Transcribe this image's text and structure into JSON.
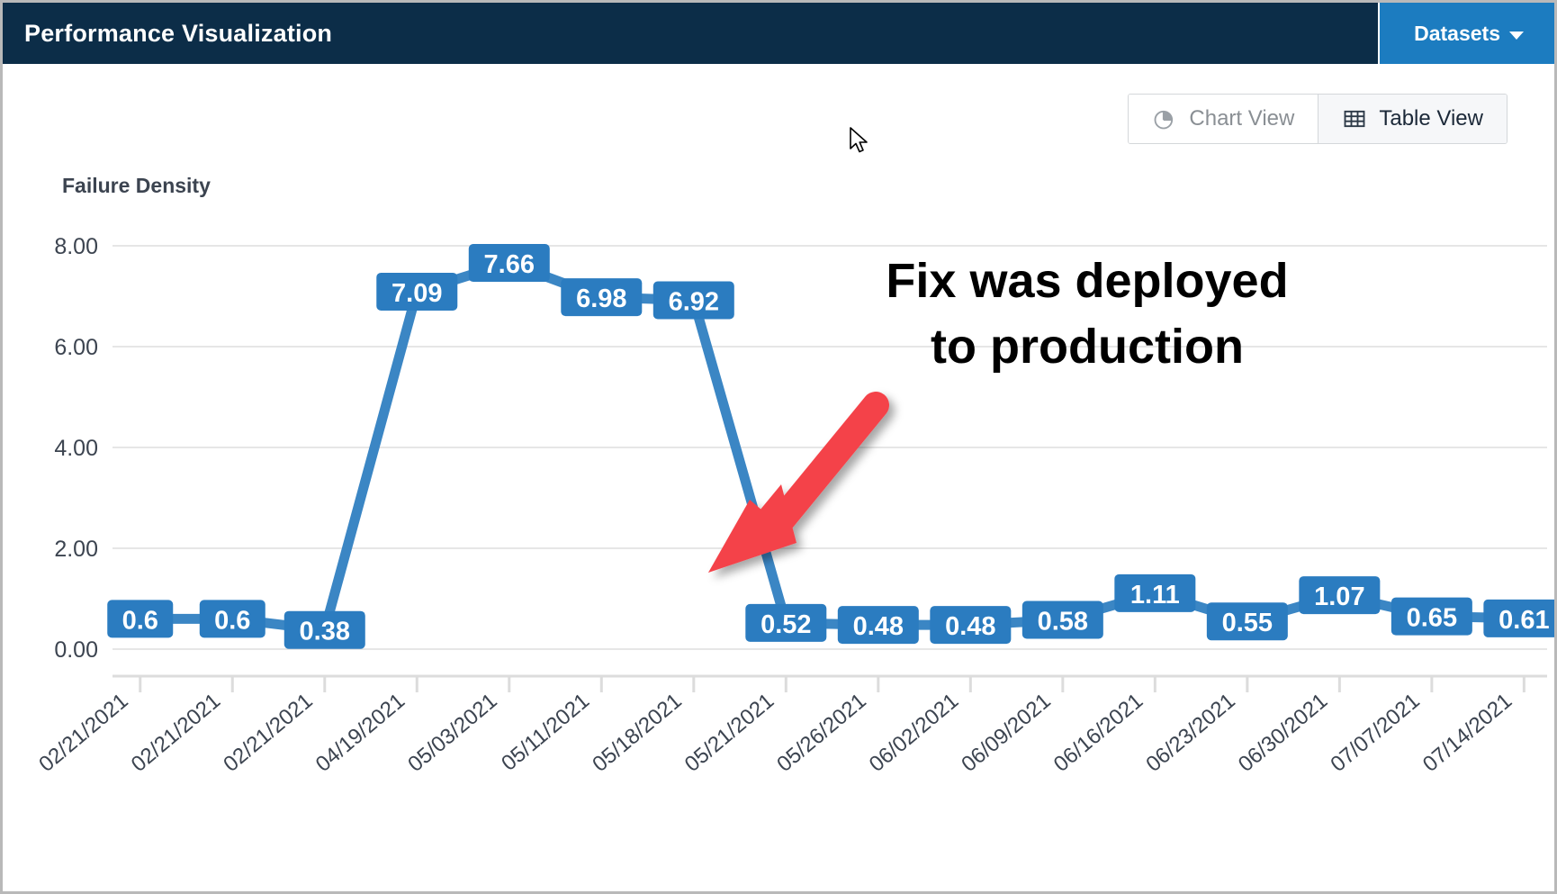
{
  "header": {
    "title": "Performance Visualization",
    "datasets_label": "Datasets",
    "caret_icon": "chevron-down-icon",
    "bg_color": "#0c2d48",
    "datasets_color": "#1c7cc0"
  },
  "view_toggle": {
    "chart_view_label": "Chart View",
    "chart_view_icon": "pie-chart-icon",
    "table_view_label": "Table View",
    "table_view_icon": "grid-table-icon",
    "active": "Table View"
  },
  "annotation": {
    "line1": "Fix was deployed",
    "line2": "to production",
    "arrow_icon": "arrow-down-left-icon",
    "arrow_color": "#f4434a"
  },
  "chart_data": {
    "type": "line",
    "title": "Failure Density",
    "xlabel": "",
    "ylabel": "",
    "ylim": [
      0,
      8
    ],
    "ytick_labels": [
      "8.00",
      "6.00",
      "4.00",
      "2.00",
      "0.00"
    ],
    "yticks": [
      8,
      6,
      4,
      2,
      0
    ],
    "grid": true,
    "legend": "none",
    "series_color": "#3b86c4",
    "label_bg_color": "#2b7cc0",
    "categories": [
      "02/21/2021",
      "02/21/2021",
      "02/21/2021",
      "04/19/2021",
      "05/03/2021",
      "05/11/2021",
      "05/18/2021",
      "05/21/2021",
      "05/26/2021",
      "06/02/2021",
      "06/09/2021",
      "06/16/2021",
      "06/23/2021",
      "06/30/2021",
      "07/07/2021",
      "07/14/2021"
    ],
    "values": [
      0.6,
      0.6,
      0.38,
      7.09,
      7.66,
      6.98,
      6.92,
      0.52,
      0.48,
      0.48,
      0.58,
      1.11,
      0.55,
      1.07,
      0.65,
      0.61
    ],
    "point_labels": [
      "0.6",
      "0.6",
      "0.38",
      "7.09",
      "7.66",
      "6.98",
      "6.92",
      "0.52",
      "0.48",
      "0.48",
      "0.58",
      "1.11",
      "0.55",
      "1.07",
      "0.65",
      "0.61"
    ]
  }
}
